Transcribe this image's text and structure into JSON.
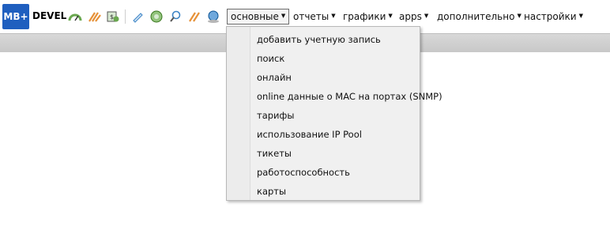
{
  "app": {
    "logo_text": "MB+",
    "brand": "DEVEL"
  },
  "toolbar_icons": [
    "gauge-icon",
    "lightning-icon",
    "money-icon",
    "tag-icon",
    "lime-icon",
    "search-icon",
    "lightning-icon",
    "globe-icon"
  ],
  "menu": [
    {
      "label": "основные",
      "name": "menu-main"
    },
    {
      "label": "отчеты",
      "name": "menu-reports"
    },
    {
      "label": "графики",
      "name": "menu-graphs"
    },
    {
      "label": "apps",
      "name": "menu-apps"
    },
    {
      "label": "дополнительно",
      "name": "menu-additional"
    },
    {
      "label": "настройки",
      "name": "menu-settings"
    }
  ],
  "dropdown": {
    "items": [
      "добавить учетную запись",
      "поиск",
      "онлайн",
      "online данные о MAC на портах (SNMP)",
      "тарифы",
      "использование IP Pool",
      "тикеты",
      "работоспособность",
      "карты"
    ]
  }
}
